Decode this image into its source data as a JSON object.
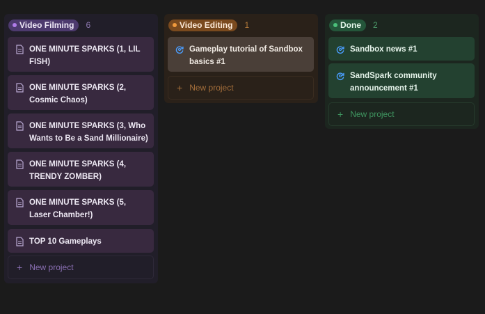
{
  "columns": [
    {
      "name": "Video Filming",
      "count": "6",
      "cards": [
        {
          "title": "ONE MINUTE SPARKS (1, LIL FISH)",
          "icon": "document-icon"
        },
        {
          "title": "ONE MINUTE SPARKS (2, Cosmic Chaos)",
          "icon": "document-icon"
        },
        {
          "title": "ONE MINUTE SPARKS (3, Who Wants to Be a Sand Millionaire)",
          "icon": "document-icon"
        },
        {
          "title": "ONE MINUTE SPARKS (4, TRENDY ZOMBER)",
          "icon": "document-icon"
        },
        {
          "title": "ONE MINUTE SPARKS (5, Laser Chamber!)",
          "icon": "document-icon"
        },
        {
          "title": "TOP 10 Gameplays",
          "icon": "document-icon"
        }
      ],
      "new_label": "New project",
      "accent": "#b07ce8"
    },
    {
      "name": "Video Editing",
      "count": "1",
      "cards": [
        {
          "title": "Gameplay tutorial of Sandbox basics #1",
          "icon": "refresh-search-icon"
        }
      ],
      "new_label": "New project",
      "accent": "#f09a3d"
    },
    {
      "name": "Done",
      "count": "2",
      "cards": [
        {
          "title": "Sandbox news #1",
          "icon": "refresh-search-icon"
        },
        {
          "title": "SandSpark community announcement #1",
          "icon": "refresh-search-icon"
        }
      ],
      "new_label": "New project",
      "accent": "#4bc07a"
    }
  ]
}
